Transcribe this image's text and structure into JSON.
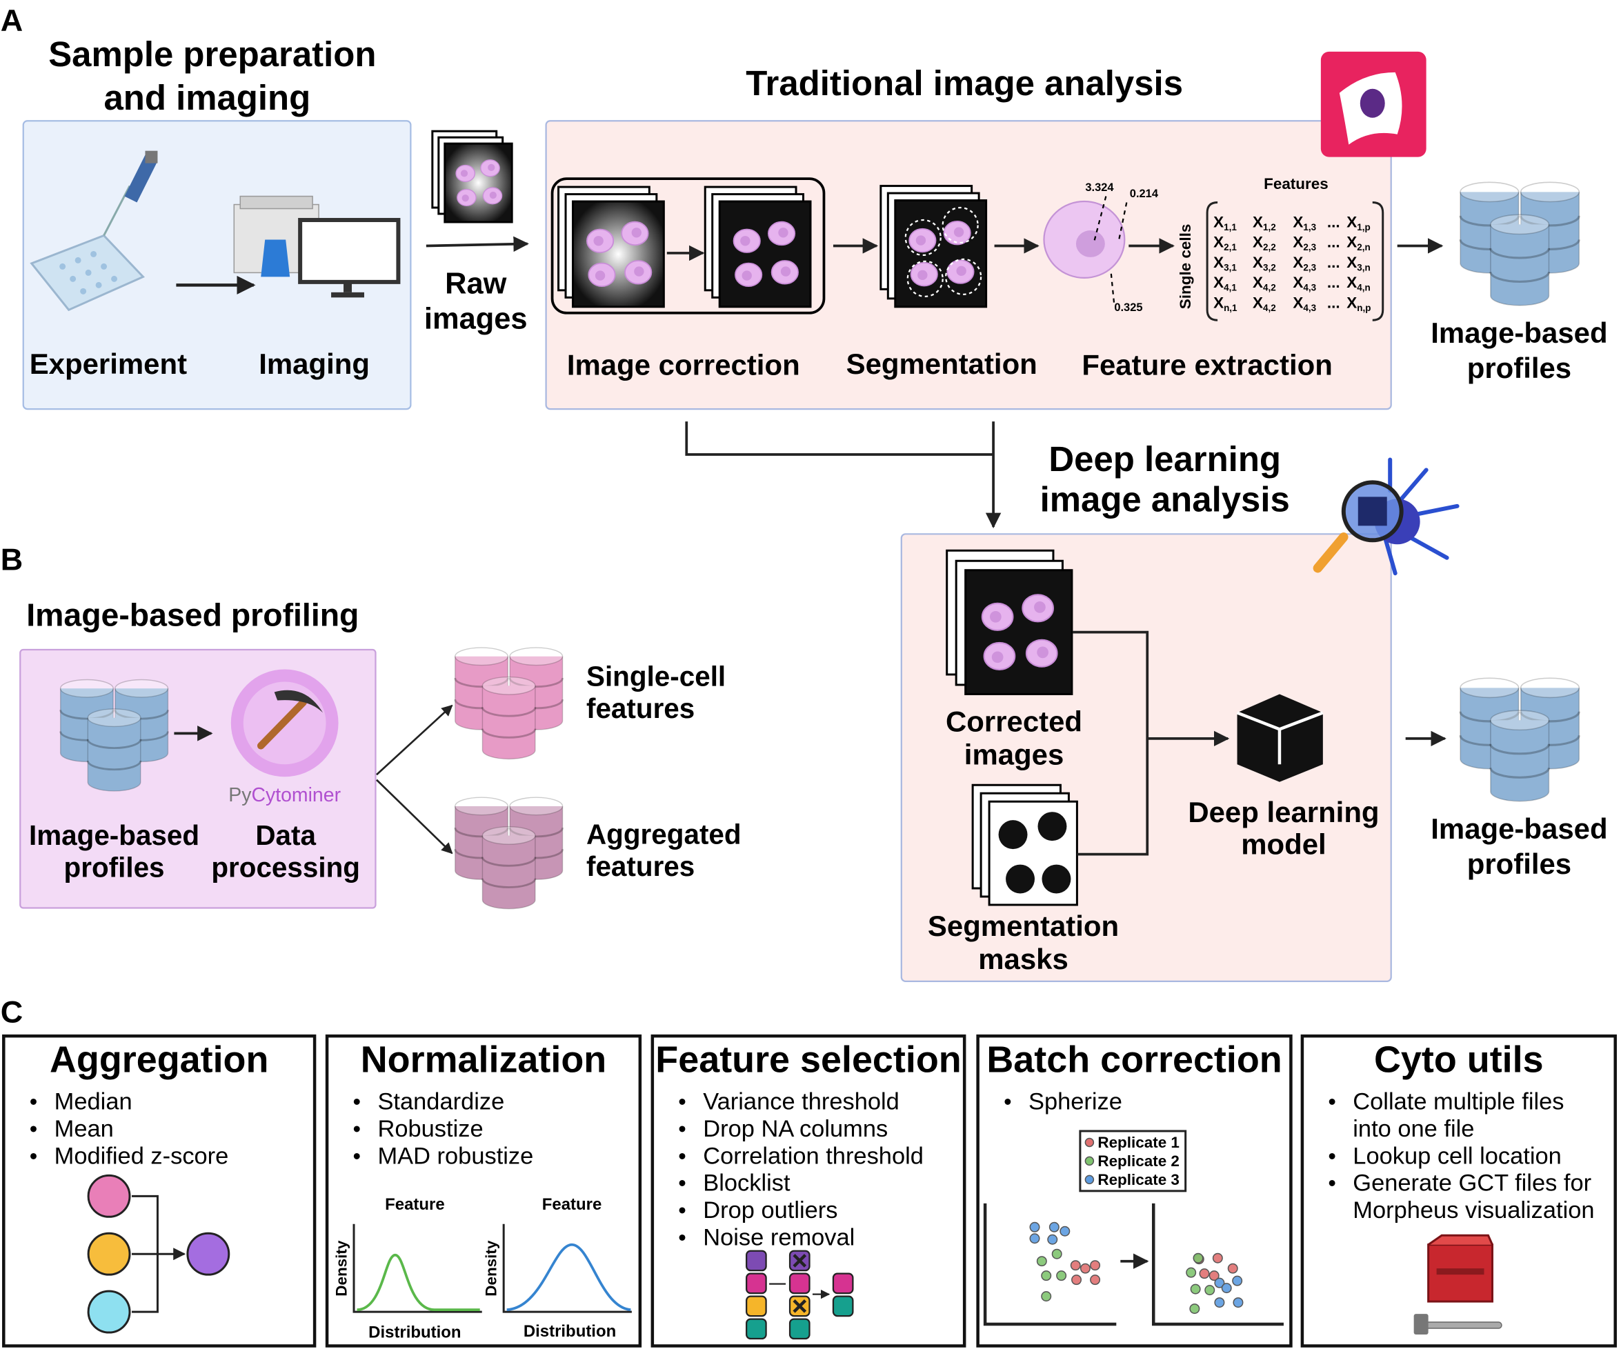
{
  "panel_letters": {
    "a": "A",
    "b": "B",
    "c": "C"
  },
  "panel_a": {
    "sample_title": [
      "Sample preparation",
      "and imaging"
    ],
    "experiment_label": "Experiment",
    "imaging_label": "Imaging",
    "raw_images_label": [
      "Raw",
      "images"
    ],
    "traditional_title": "Traditional image analysis",
    "image_correction_label": "Image correction",
    "segmentation_label": "Segmentation",
    "feature_extraction_label": "Feature extraction",
    "feature_values": [
      "3.324",
      "0.214",
      "0.325"
    ],
    "features_header": "Features",
    "single_cells_label": "Single cells",
    "matrix": [
      [
        "X|1,1",
        "X|1,2",
        "X|1,3",
        "...",
        "X|1,p"
      ],
      [
        "X|2,1",
        "X|2,2",
        "X|2,3",
        "...",
        "X|2,n"
      ],
      [
        "X|3,1",
        "X|3,2",
        "X|2,3",
        "...",
        "X|3,n"
      ],
      [
        "X|4,1",
        "X|4,2",
        "X|4,3",
        "...",
        "X|4,n"
      ],
      [
        "X|n,1",
        "X|4,2",
        "X|4,3",
        "...",
        "X|n,p"
      ]
    ],
    "profiles_label": [
      "Image-based",
      "profiles"
    ],
    "deep_title": [
      "Deep learning",
      "image analysis"
    ],
    "corrected_images_label": [
      "Corrected",
      "images"
    ],
    "segmentation_masks_label": [
      "Segmentation",
      "masks"
    ],
    "deep_model_label": [
      "Deep learning",
      "model"
    ],
    "deep_profiles_label": [
      "Image-based",
      "profiles"
    ]
  },
  "panel_b": {
    "title": "Image-based profiling",
    "profiles_label": [
      "Image-based",
      "profiles"
    ],
    "processing_label": [
      "Data",
      "processing"
    ],
    "logo_py": "Py",
    "logo_cytominer": "Cytominer",
    "single_cell_label": [
      "Single-cell",
      "features"
    ],
    "aggregated_label": [
      "Aggregated",
      "features"
    ]
  },
  "panel_c": [
    {
      "title": "Aggregation",
      "items": [
        [
          "Median"
        ],
        [
          "Mean"
        ],
        [
          "Modified z-score"
        ]
      ]
    },
    {
      "title": "Normalization",
      "items": [
        [
          "Standardize"
        ],
        [
          "Robustize"
        ],
        [
          "MAD robustize"
        ]
      ]
    },
    {
      "title": "Feature selection",
      "items": [
        [
          "Variance threshold"
        ],
        [
          "Drop NA columns"
        ],
        [
          "Correlation threshold"
        ],
        [
          "Blocklist"
        ],
        [
          "Drop outliers"
        ],
        [
          "Noise removal"
        ]
      ]
    },
    {
      "title": "Batch correction",
      "items": [
        [
          "Spherize"
        ]
      ]
    },
    {
      "title": "Cyto utils",
      "items": [
        [
          "Collate multiple files",
          "into one file"
        ],
        [
          "Lookup cell location"
        ],
        [
          "Generate GCT files for",
          "Morpheus visualization"
        ]
      ]
    }
  ],
  "density_plots": {
    "feature_label": "Feature",
    "density_label": "Density",
    "distribution_label": "Distribution"
  },
  "batch_legend": [
    "Replicate 1",
    "Replicate 2",
    "Replicate 3"
  ],
  "colors": {
    "sample_box": "#eaf1fb",
    "analysis_box": "#fdecea",
    "profiling_box": "#f3dbf6",
    "app_icon": "#e8235f",
    "database_blue": "#8fb3d6",
    "database_pink": "#e79bc6",
    "database_mauve": "#c795b5",
    "cell": "#e6b3ee",
    "replicate_1": "#e07070",
    "replicate_2": "#7fc46f",
    "replicate_3": "#5c9be0"
  },
  "icons": [
    "pipette-icon",
    "well-plate-icon",
    "microscope-icon",
    "monitor-icon",
    "cell-app-icon",
    "magnifier-neuron-icon",
    "pickaxe-logo-icon",
    "cube-icon",
    "toolbox-icon",
    "database-icon"
  ]
}
